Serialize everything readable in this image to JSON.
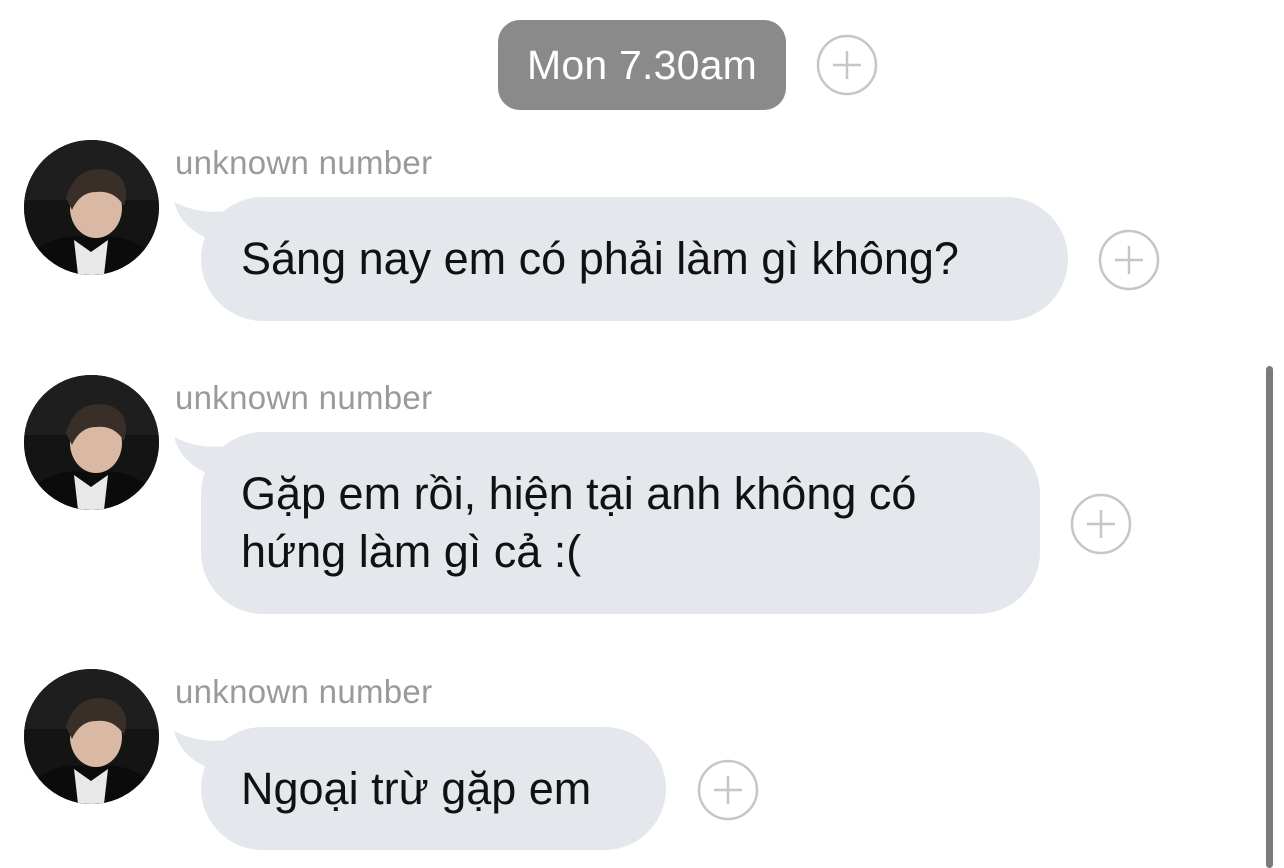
{
  "timestamp": "Mon 7.30am",
  "messages": [
    {
      "sender": "unknown number",
      "text": "Sáng nay em có phải làm gì không?"
    },
    {
      "sender": "unknown number",
      "text": "Gặp em rồi, hiện tại anh không có\nhứng làm gì cả :("
    },
    {
      "sender": "unknown number",
      "text": "Ngoại trừ gặp em"
    }
  ],
  "icons": {
    "add": "plus-circle-icon",
    "avatar": "profile-photo"
  },
  "colors": {
    "timestamp_bg": "#8a8a8a",
    "bubble_bg": "#e4e7eb",
    "sender_text": "#9a9a9a",
    "plus_stroke": "#c6c6c6"
  }
}
